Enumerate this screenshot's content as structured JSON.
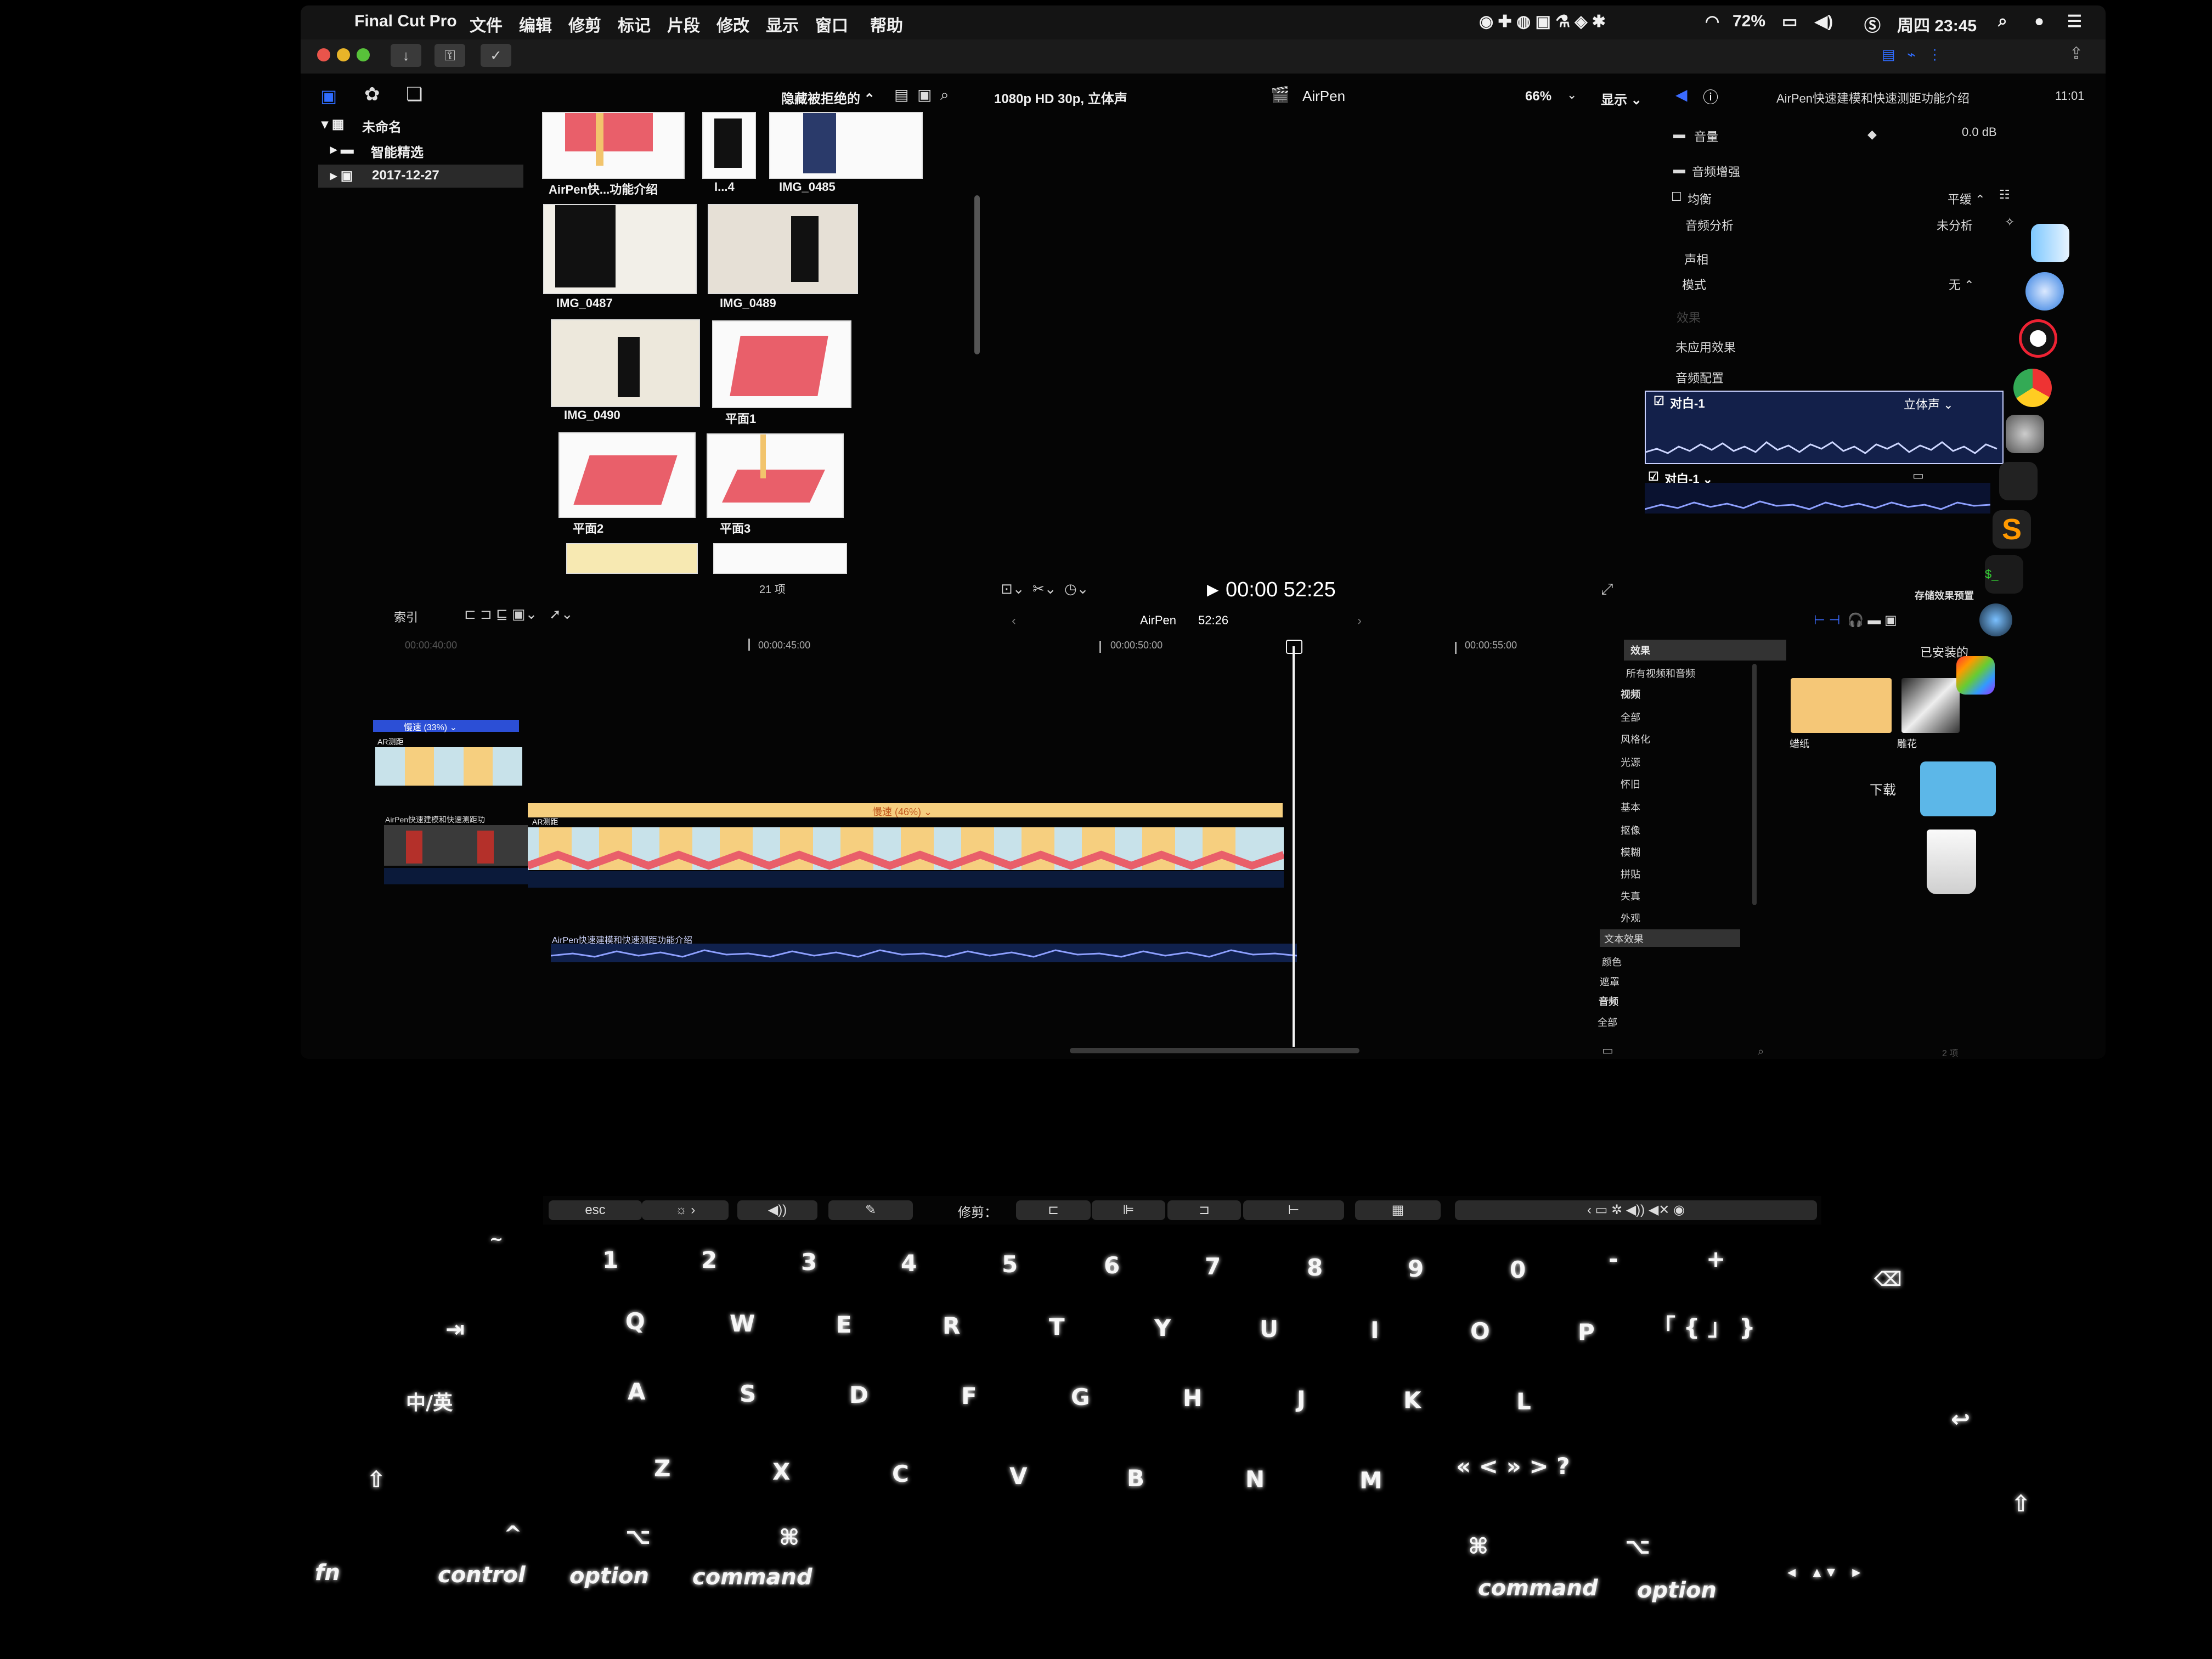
{
  "menubar": {
    "apple": "",
    "items": [
      "Final Cut Pro",
      "文件",
      "编辑",
      "修剪",
      "标记",
      "片段",
      "修改",
      "显示",
      "窗口",
      "帮助"
    ],
    "battery": "72%",
    "clock": "周四 23:45"
  },
  "browser": {
    "filter_label": "隐藏被拒绝的 ⌃",
    "library": "未命名",
    "smart_collection": "智能精选",
    "event": "2017-12-27",
    "clips": [
      {
        "label": "AirPen快...功能介绍"
      },
      {
        "label": "I...4"
      },
      {
        "label": "IMG_0485"
      },
      {
        "label": "IMG_0487"
      },
      {
        "label": "IMG_0489"
      },
      {
        "label": "IMG_0490"
      },
      {
        "label": "平面1"
      },
      {
        "label": "平面2"
      },
      {
        "label": "平面3"
      }
    ],
    "item_count": "21 项"
  },
  "viewer": {
    "format": "1080p HD 30p, 立体声",
    "project": "AirPen",
    "zoom": "66%",
    "display_menu": "显示 ⌄",
    "timecode": "00:00 52:25"
  },
  "inspector": {
    "title": "AirPen快速建模和快速测距功能介绍",
    "duration": "11:01",
    "volume_label": "音量",
    "volume_value": "0.0 dB",
    "audio_enhance": "音频增强",
    "balance": "均衡",
    "balance_value": "平缓 ⌃",
    "analysis": "音频分析",
    "analysis_value": "未分析",
    "pan": "声相",
    "mode": "模式",
    "mode_value": "无 ⌃",
    "effects": "效果",
    "no_effects": "未应用效果",
    "audio_config": "音频配置",
    "track1": "对白-1",
    "track1_type": "立体声 ⌄",
    "track2": "对白-1 ⌄",
    "save_preset": "存储效果预置"
  },
  "timeline": {
    "index_label": "索引",
    "project": "AirPen",
    "duration": "52:26",
    "ruler": [
      "00:00:40:00",
      "00:00:45:00",
      "00:00:50:00",
      "00:00:55:00"
    ],
    "clip_speed_small": "慢速 (33%) ⌄",
    "clip_name_small": "AR测距",
    "clip_speed_main": "慢速 (46%) ⌄",
    "clip_name_main": "AR测距",
    "primary_clip_label": "AirPen快速建模和快速测距功",
    "audio_clip": "AirPen快速建模和快速测距功能介绍"
  },
  "effects_browser": {
    "header": "效果",
    "all_video_audio": "所有视频和音频",
    "categories": [
      "视频",
      "全部",
      "风格化",
      "光源",
      "怀旧",
      "基本",
      "抠像",
      "模糊",
      "拼贴",
      "失真",
      "外观",
      "文本效果",
      "颜色",
      "遮罩",
      "音频",
      "全部"
    ],
    "installed": "已安装的",
    "effect1": "蜡纸",
    "effect2": "雕花",
    "count": "2 项"
  },
  "dock": {
    "downloads": "下载"
  },
  "touchbar": {
    "esc": "esc",
    "trim_label": "修剪："
  },
  "keyboard": {
    "number_row": [
      "~",
      "1",
      "2",
      "3",
      "4",
      "5",
      "6",
      "7",
      "8",
      "9",
      "0",
      "-",
      "+"
    ],
    "number_row_top": [
      "`",
      "!",
      "@",
      "#",
      "¥ $",
      "%",
      "… ^",
      "&",
      "*",
      "(",
      ")",
      "—",
      "="
    ],
    "row_q": [
      "Q",
      "W",
      "E",
      "R",
      "T",
      "Y",
      "U",
      "I",
      "O",
      "P"
    ],
    "row_a": [
      "A",
      "S",
      "D",
      "F",
      "G",
      "H",
      "J",
      "K",
      "L"
    ],
    "row_z": [
      "Z",
      "X",
      "C",
      "V",
      "B",
      "N",
      "M"
    ],
    "tab": "⇥",
    "caps": "中/英",
    "shift": "⇧",
    "return": "↩",
    "delete": "⌫",
    "fn": "fn",
    "control": "control",
    "option_left": "option",
    "command_left": "command",
    "command_right": "command",
    "option_right": "option",
    "cmd_glyph": "⌘",
    "ctrl_glyph": "^",
    "opt_glyph": "⌥"
  },
  "colors": {
    "accent": "#2f6cff",
    "clip_bar": "#f6cf7f",
    "thumb_pink": "#e95f6a",
    "wave_blue": "#13204a"
  }
}
